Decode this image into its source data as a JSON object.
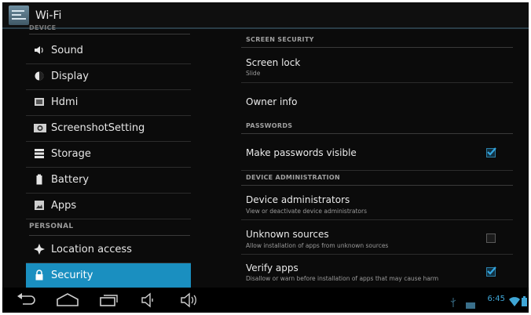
{
  "action_bar": {
    "title": "Wi-Fi",
    "app_icon": "settings-app-icon"
  },
  "left_pane": {
    "device_header": "DEVICE",
    "device_items": [
      {
        "label": "Sound",
        "icon": "speaker-icon"
      },
      {
        "label": "Display",
        "icon": "brightness-icon"
      },
      {
        "label": "Hdmi",
        "icon": "hdmi-icon"
      },
      {
        "label": "ScreenshotSetting",
        "icon": "camera-icon"
      },
      {
        "label": "Storage",
        "icon": "storage-icon"
      },
      {
        "label": "Battery",
        "icon": "battery-icon"
      },
      {
        "label": "Apps",
        "icon": "apps-icon"
      }
    ],
    "personal_header": "PERSONAL",
    "personal_items": [
      {
        "label": "Location access",
        "icon": "location-icon"
      },
      {
        "label": "Security",
        "icon": "lock-icon",
        "selected": true
      }
    ]
  },
  "right_pane": {
    "screen_security_header": "SCREEN SECURITY",
    "screen_lock": {
      "title": "Screen lock",
      "summary": "Slide"
    },
    "owner_info": {
      "title": "Owner info"
    },
    "passwords_header": "PASSWORDS",
    "make_passwords_visible": {
      "title": "Make passwords visible",
      "checked": true
    },
    "device_admin_header": "DEVICE ADMINISTRATION",
    "device_administrators": {
      "title": "Device administrators",
      "summary": "View or deactivate device administrators"
    },
    "unknown_sources": {
      "title": "Unknown sources",
      "summary": "Allow installation of apps from unknown sources",
      "checked": false
    },
    "verify_apps": {
      "title": "Verify apps",
      "summary": "Disallow or warn before installation of apps that may cause harm",
      "checked": true
    }
  },
  "nav_bar": {
    "buttons": [
      "back-icon",
      "home-icon",
      "recents-icon",
      "volume-down-icon",
      "volume-up-icon"
    ]
  },
  "status_bar": {
    "time": "6:45",
    "icons": [
      "usb-icon",
      "storage-card-icon",
      "wifi-icon",
      "battery-icon"
    ]
  },
  "colors": {
    "accent": "#1a8fc0",
    "clock": "#3fa6d6",
    "background": "#0b0b0b"
  }
}
